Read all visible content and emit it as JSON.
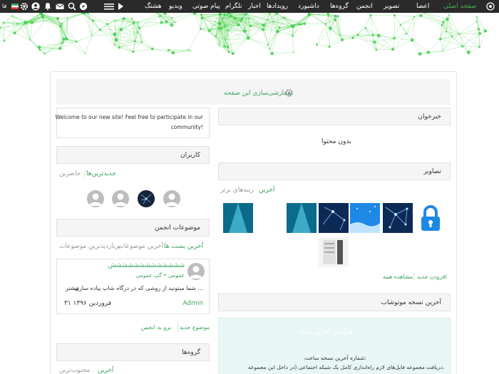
{
  "nav": {
    "items": [
      {
        "label": "صفحه اصلی",
        "active": true
      },
      {
        "label": "هشتگ"
      },
      {
        "label": "ویدیو"
      },
      {
        "label": "پیام صوتی"
      },
      {
        "label": "تلگرام"
      },
      {
        "label": "اخبار"
      },
      {
        "label": "رویدادها"
      },
      {
        "label": "داشبورد"
      },
      {
        "label": "گروه‌ها"
      },
      {
        "label": "انجمن"
      },
      {
        "label": "تصویر"
      },
      {
        "label": "اعضا"
      }
    ],
    "lang_label": "فا"
  },
  "customize": {
    "label": "سفارشی‌سازی این صفحه"
  },
  "welcome": {
    "text_line1": "Welcome to our new site! Feel free to participate in our",
    "text_line2": "community!"
  },
  "news": {
    "title": "خبرخوان",
    "empty": "بدون محتوا"
  },
  "users": {
    "title": "کاربران",
    "tab_newest": "جدیدترین‌ها",
    "tab_online": "حاضرین"
  },
  "photos": {
    "title": "تصاویر",
    "tab_latest": "آخرین",
    "tab_top": "رتبه‌های برتر",
    "add_new": "افزودن جدید",
    "view_all": "مشاهده همه"
  },
  "forum": {
    "title": "موضوعات انجمن",
    "tab_latest_posts": "آخرین پست ها",
    "tab_latest_topics": "آخرین موضوعات",
    "tab_most_viewed": "پربازدیدترین موضوعات",
    "post_title": "ششششششششششششش",
    "post_category": "عمومی • گپ عمومی",
    "post_excerpt": "شما میتونید از روشی که در درگاه شاپ پیاده سازی ...",
    "post_more": "بیشتر",
    "post_author": "Admin",
    "post_date": "۳۱ فروردین ۱۳۹۶",
    "new_topic": "موضوع جدید",
    "go_forum": "برو به انجمن"
  },
  "version": {
    "title": "آخرین نسخه موتوشاب",
    "banner_title": "بارگیری آخرین نسخه",
    "line1": "شماره آخرین نسخه ساخت:",
    "line2": "دریافت مجموعه فایل‌های لازم راه‌اندازی کامل یک شبکه اجتماعی (در داخل این مجموعه،"
  },
  "groups": {
    "title": "گروه‌ها",
    "tab_latest": "آخرین",
    "tab_popular": "محبوب‌ترین"
  },
  "colors": {
    "accent": "#3aa35f",
    "nav_bg": "#2a2a2a"
  }
}
